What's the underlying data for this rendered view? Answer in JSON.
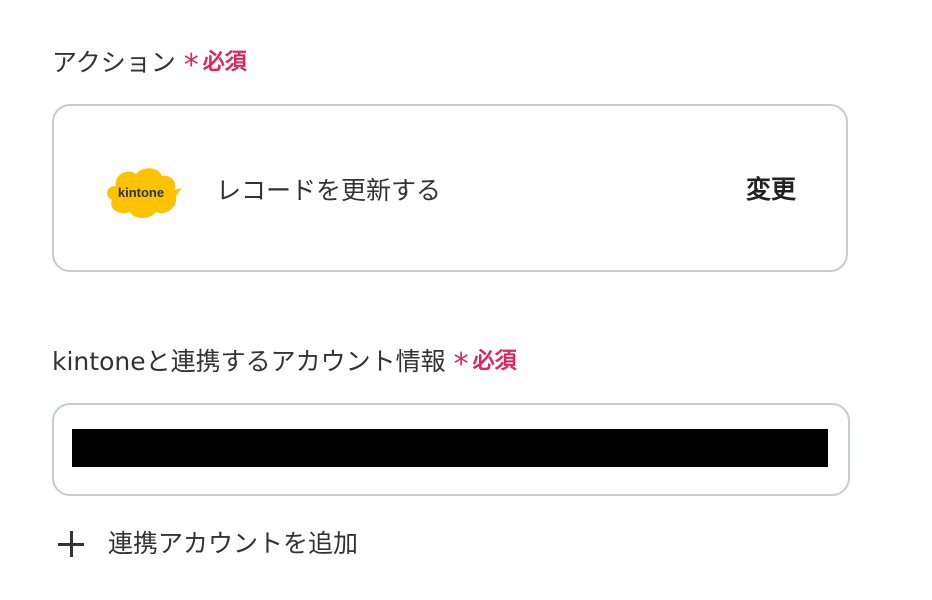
{
  "action_field": {
    "label": "アクション",
    "required_mark": "*",
    "required_text": "必須"
  },
  "action_card": {
    "logo_text": "kintone",
    "logo_color": "#fdc300",
    "action_name": "レコードを更新する",
    "change_label": "変更"
  },
  "account_field": {
    "label": "kintoneと連携するアカウント情報",
    "required_mark": "*",
    "required_text": "必須"
  },
  "add_account": {
    "label": "連携アカウントを追加",
    "icon": "plus-icon"
  },
  "colors": {
    "required": "#e0245e",
    "border": "#c4ccd4",
    "text": "#333333"
  }
}
